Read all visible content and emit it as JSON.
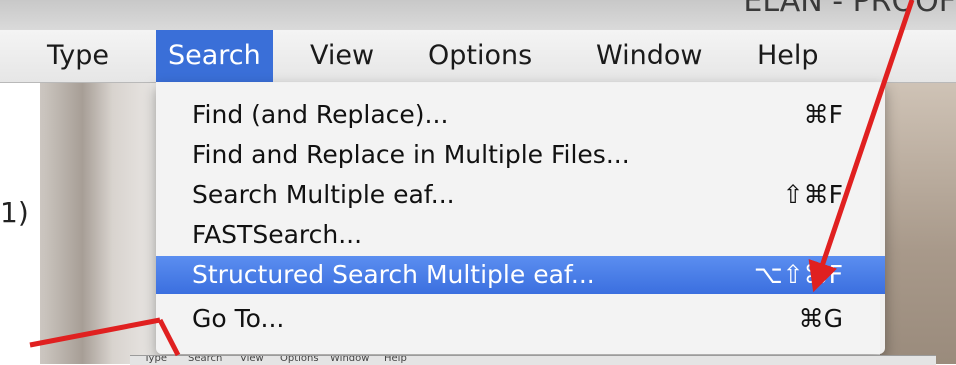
{
  "window": {
    "title_fragment": "ELAN - PROOF"
  },
  "menubar": {
    "items": [
      {
        "label": "Type"
      },
      {
        "label": "Search"
      },
      {
        "label": "View"
      },
      {
        "label": "Options"
      },
      {
        "label": "Window"
      },
      {
        "label": "Help"
      }
    ],
    "active": "Search"
  },
  "dropdown": {
    "items": [
      {
        "label": "Find (and Replace)...",
        "shortcut": "⌘F"
      },
      {
        "label": "Find and Replace in Multiple Files...",
        "shortcut": ""
      },
      {
        "label": "Search Multiple eaf...",
        "shortcut": "⇧⌘F"
      },
      {
        "label": "FASTSearch...",
        "shortcut": ""
      },
      {
        "label": "Structured Search Multiple eaf...",
        "shortcut": "⌥⇧⌘F"
      },
      {
        "label": "Go To...",
        "shortcut": "⌘G"
      }
    ],
    "highlighted_index": 4
  },
  "left_fragment": "1)",
  "mini_menubar": {
    "items": [
      "Type",
      "Search",
      "View",
      "Options",
      "Window",
      "Help"
    ]
  },
  "colors": {
    "highlight": "#3b6fdf",
    "arrow": "#e02020"
  }
}
